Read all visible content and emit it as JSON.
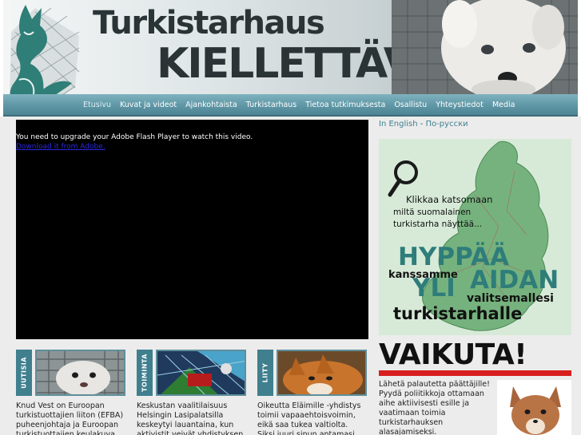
{
  "header": {
    "title_line1": "Turkistarhaus",
    "title_line2": "KIELLETTÄVÄ"
  },
  "nav": {
    "items": [
      {
        "label": "Etusivu",
        "active": true
      },
      {
        "label": "Kuvat ja videot",
        "active": false
      },
      {
        "label": "Ajankohtaista",
        "active": false
      },
      {
        "label": "Turkistarhaus",
        "active": false
      },
      {
        "label": "Tietoa tutkimuksesta",
        "active": false
      },
      {
        "label": "Osallistu",
        "active": false
      },
      {
        "label": "Yhteystiedot",
        "active": false
      },
      {
        "label": "Media",
        "active": false
      }
    ]
  },
  "video": {
    "message": "You need to upgrade your Adobe Flash Player to watch this video.",
    "link": "Download it from Adobe."
  },
  "cards": [
    {
      "tab": "UUTISIA",
      "text": "Knud Vest on Euroopan turkistuottajien liiton (EFBA) puheenjohtaja ja Euroopan turkistuottajien keulakuva.",
      "icon": "mink-photo"
    },
    {
      "tab": "TOIMINTA",
      "text": "Keskustan vaalitilaisuus Helsingin Lasipalatsilla keskeytyi lauantaina, kun aktivistit veivät yhdistyksen",
      "icon": "fur-farm-photo"
    },
    {
      "tab": "LIITY",
      "text": "Oikeutta Eläimille -yhdistys toimii vapaaehtoisvoimin, eikä saa tukea valtiolta. Siksi juuri sinun antamasi",
      "icon": "fox-photo"
    }
  ],
  "languages": {
    "english": "In English",
    "separator": "-",
    "russian": "По-русски"
  },
  "map_ad": {
    "line1": "Klikkaa katsomaan",
    "line2": "miltä suomalainen",
    "line3": "turkistarha näyttää...",
    "big1": "HYPPÄÄ",
    "small1": "kanssamme",
    "big2": "AIDAN",
    "big3": "YLI",
    "small2": "valitsemallesi",
    "big4": "turkistarhalle"
  },
  "vaikuta": {
    "heading": "VAIKUTA!",
    "text": "Lähetä palautetta päättäjille! Pyydä poliitikkoja ottamaan aihe aktiivisesti esille ja vaatimaan toimia turkistarhauksen alasajamiseksi."
  },
  "colors": {
    "nav": "#5f97a6",
    "accent": "#3f7f8e",
    "red": "#d71f1f"
  }
}
